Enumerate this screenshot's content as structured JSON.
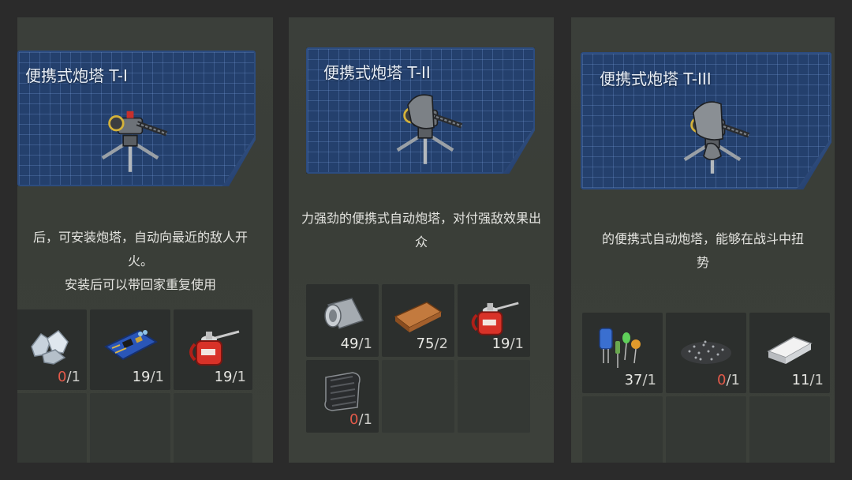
{
  "panels": [
    {
      "title": "便携式炮塔 T-I",
      "desc_lines": [
        "后，可安装炮塔，自动向最近的敌人开",
        "火。",
        "安装后可以带回家重复使用"
      ],
      "materials": [
        {
          "icon": "metal-ore-icon",
          "have": "0",
          "need": "/1",
          "short": true
        },
        {
          "icon": "circuit-board-icon",
          "have": "19",
          "need": "/1",
          "short": false
        },
        {
          "icon": "oil-can-icon",
          "have": "19",
          "need": "/1",
          "short": false
        }
      ]
    },
    {
      "title": "便携式炮塔 T-II",
      "desc_lines": [
        "力强劲的便携式自动炮塔，对付强敌效果出",
        "众"
      ],
      "materials": [
        {
          "icon": "metal-sheet-roll-icon",
          "have": "49",
          "need": "/1",
          "short": false
        },
        {
          "icon": "wood-plank-icon",
          "have": "75",
          "need": "/2",
          "short": false
        },
        {
          "icon": "oil-can-icon",
          "have": "19",
          "need": "/1",
          "short": false
        },
        {
          "icon": "carbon-fiber-icon",
          "have": "0",
          "need": "/1",
          "short": true
        }
      ]
    },
    {
      "title": "便携式炮塔 T-III",
      "desc_lines": [
        "的便携式自动炮塔，能够在战斗中扭",
        "势"
      ],
      "materials": [
        {
          "icon": "electronic-components-icon",
          "have": "37",
          "need": "/1",
          "short": false
        },
        {
          "icon": "gunpowder-icon",
          "have": "0",
          "need": "/1",
          "short": true
        },
        {
          "icon": "silver-ingot-icon",
          "have": "11",
          "need": "/1",
          "short": false
        }
      ]
    }
  ],
  "colors": {
    "shortage": "#e45a4a",
    "blueprint": "#24406d",
    "panel": "#3b3f3a"
  }
}
